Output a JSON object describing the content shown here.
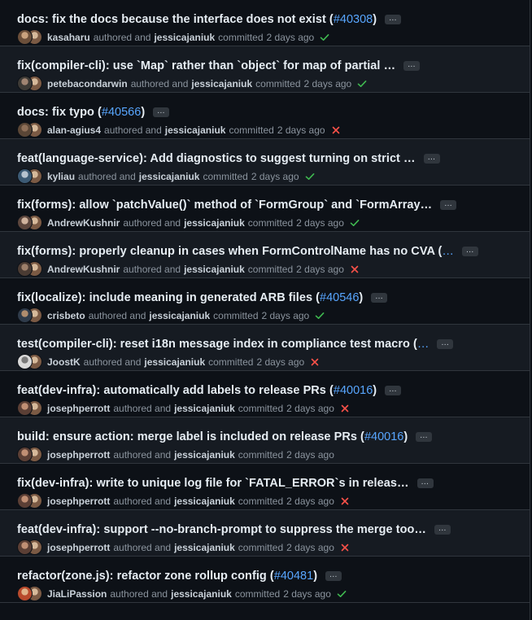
{
  "labels": {
    "authored": "authored and",
    "committed": "committed",
    "more": "…"
  },
  "colors": {
    "link": "#58a6ff",
    "success": "#3fb950",
    "failure": "#f85149",
    "muted": "#8b949e"
  },
  "commits": [
    {
      "message": "docs: fix the docs because the interface does not exist (",
      "pr": "#40308",
      "pr_end": ")",
      "author": "kasaharu",
      "committer": "jessicajaniuk",
      "time": "2 days ago",
      "status": "success",
      "status_icon": "check-icon"
    },
    {
      "message": "fix(compiler-cli): use `Map` rather than `object` for map of partial …",
      "pr": "",
      "pr_end": "",
      "author": "petebacondarwin",
      "committer": "jessicajaniuk",
      "time": "2 days ago",
      "status": "success",
      "status_icon": "check-icon"
    },
    {
      "message": "docs: fix typo (",
      "pr": "#40566",
      "pr_end": ")",
      "author": "alan-agius4",
      "committer": "jessicajaniuk",
      "time": "2 days ago",
      "status": "failure",
      "status_icon": "x-icon"
    },
    {
      "message": "feat(language-service): Add diagnostics to suggest turning on strict …",
      "pr": "",
      "pr_end": "",
      "author": "kyliau",
      "committer": "jessicajaniuk",
      "time": "2 days ago",
      "status": "success",
      "status_icon": "check-icon"
    },
    {
      "message": "fix(forms): allow `patchValue()` method of `FormGroup` and `FormArray…",
      "pr": "",
      "pr_end": "",
      "author": "AndrewKushnir",
      "committer": "jessicajaniuk",
      "time": "2 days ago",
      "status": "success",
      "status_icon": "check-icon"
    },
    {
      "message": "fix(forms): properly cleanup in cases when FormControlName has no CVA (",
      "pr": "…",
      "pr_end": "",
      "author": "AndrewKushnir",
      "committer": "jessicajaniuk",
      "time": "2 days ago",
      "status": "failure",
      "status_icon": "x-icon"
    },
    {
      "message": "fix(localize): include meaning in generated ARB files (",
      "pr": "#40546",
      "pr_end": ")",
      "author": "crisbeto",
      "committer": "jessicajaniuk",
      "time": "2 days ago",
      "status": "success",
      "status_icon": "check-icon"
    },
    {
      "message": "test(compiler-cli): reset i18n message index in compliance test macro (",
      "pr": "…",
      "pr_end": "",
      "author": "JoostK",
      "committer": "jessicajaniuk",
      "time": "2 days ago",
      "status": "failure",
      "status_icon": "x-icon"
    },
    {
      "message": "feat(dev-infra): automatically add labels to release PRs (",
      "pr": "#40016",
      "pr_end": ")",
      "author": "josephperrott",
      "committer": "jessicajaniuk",
      "time": "2 days ago",
      "status": "failure",
      "status_icon": "x-icon"
    },
    {
      "message": "build: ensure action: merge label is included on release PRs (",
      "pr": "#40016",
      "pr_end": ")",
      "author": "josephperrott",
      "committer": "jessicajaniuk",
      "time": "2 days ago",
      "status": "none",
      "status_icon": ""
    },
    {
      "message": "fix(dev-infra): write to unique log file for `FATAL_ERROR`s in releas…",
      "pr": "",
      "pr_end": "",
      "author": "josephperrott",
      "committer": "jessicajaniuk",
      "time": "2 days ago",
      "status": "failure",
      "status_icon": "x-icon"
    },
    {
      "message": "feat(dev-infra): support --no-branch-prompt to suppress the merge too…",
      "pr": "",
      "pr_end": "",
      "author": "josephperrott",
      "committer": "jessicajaniuk",
      "time": "2 days ago",
      "status": "failure",
      "status_icon": "x-icon"
    },
    {
      "message": "refactor(zone.js): refactor zone rollup config (",
      "pr": "#40481",
      "pr_end": ")",
      "author": "JiaLiPassion",
      "committer": "jessicajaniuk",
      "time": "2 days ago",
      "status": "success",
      "status_icon": "check-icon"
    }
  ]
}
